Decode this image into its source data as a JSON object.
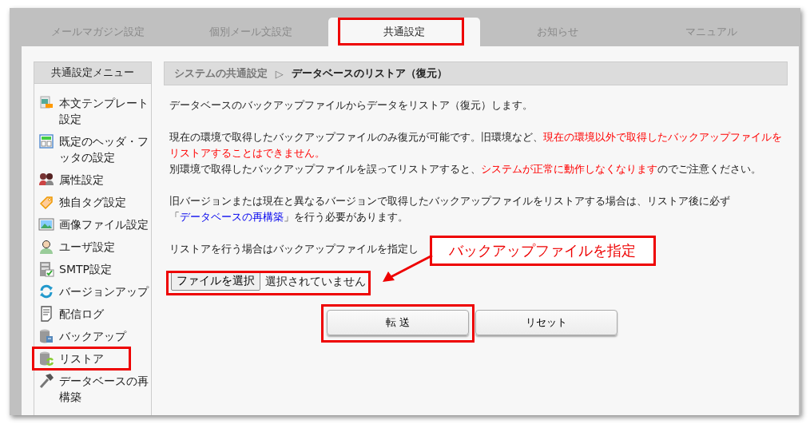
{
  "tabs": [
    {
      "label": "メールマガジン設定",
      "selected": false,
      "boxed": false
    },
    {
      "label": "個別メール文設定",
      "selected": false,
      "boxed": false
    },
    {
      "label": "共通設定",
      "selected": true,
      "boxed": true
    },
    {
      "label": "お知らせ",
      "selected": false,
      "boxed": false
    },
    {
      "label": "マニュアル",
      "selected": false,
      "boxed": false
    }
  ],
  "sidebar": {
    "title": "共通設定メニュー",
    "items": [
      {
        "label": "本文テンプレート設定",
        "boxed": false
      },
      {
        "label": "既定のヘッダ・フッタの設定",
        "boxed": false
      },
      {
        "label": "属性設定",
        "boxed": false
      },
      {
        "label": "独自タグ設定",
        "boxed": false
      },
      {
        "label": "画像ファイル設定",
        "boxed": false
      },
      {
        "label": "ユーザ設定",
        "boxed": false
      },
      {
        "label": "SMTP設定",
        "boxed": false
      },
      {
        "label": "バージョンアップ",
        "boxed": false
      },
      {
        "label": "配信ログ",
        "boxed": false
      },
      {
        "label": "バックアップ",
        "boxed": false
      },
      {
        "label": "リストア",
        "boxed": true
      },
      {
        "label": "データベースの再構築",
        "boxed": false
      }
    ]
  },
  "breadcrumb": {
    "parent": "システムの共通設定",
    "separator": "▷",
    "current": "データベースのリストア（復元）"
  },
  "blocks": [
    {
      "lines": [
        [
          {
            "text": "データベースのバックアップファイルからデータをリストア（復元）します。",
            "kind": "plain"
          }
        ]
      ]
    },
    {
      "lines": [
        [
          {
            "text": "現在の環境で取得したバックアップファイルのみ復元が可能です。旧環境など、",
            "kind": "plain"
          },
          {
            "text": "現在の環境以外で取得したバックアップファイルをリストアすることはできません。",
            "kind": "warning"
          }
        ],
        [
          {
            "text": "別環境で取得したバックアップファイルを誤ってリストアすると、",
            "kind": "plain"
          },
          {
            "text": "システムが正常に動作しなくなります",
            "kind": "warning"
          },
          {
            "text": "のでご注意ください。",
            "kind": "plain"
          }
        ]
      ]
    },
    {
      "lines": [
        [
          {
            "text": "旧バージョンまたは現在と異なるバージョンで取得したバックアップファイルをリストアする場合は、リストア後に必ず「",
            "kind": "plain"
          },
          {
            "text": "データベースの再構築",
            "kind": "link"
          },
          {
            "text": "」を行う必要があります。",
            "kind": "plain"
          }
        ]
      ]
    },
    {
      "lines": [
        [
          {
            "text": "リストアを行う場合はバックアップファイルを指定し",
            "kind": "plain"
          }
        ]
      ]
    }
  ],
  "file_input": {
    "button": "ファイルを選択",
    "status": "選択されていません",
    "boxed": true
  },
  "buttons": [
    {
      "label": "転 送",
      "boxed": true
    },
    {
      "label": "リセット",
      "boxed": false
    }
  ],
  "callout": {
    "text": "バックアップファイルを指定"
  }
}
